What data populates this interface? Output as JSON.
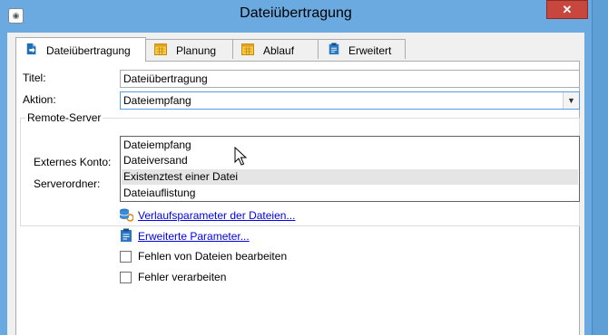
{
  "window": {
    "title": "Dateiübertragung",
    "close_glyph": "✕"
  },
  "tabs": [
    {
      "label": "Dateiübertragung",
      "icon": "file-transfer-icon"
    },
    {
      "label": "Planung",
      "icon": "calendar-icon"
    },
    {
      "label": "Ablauf",
      "icon": "calendar-icon"
    },
    {
      "label": "Erweitert",
      "icon": "clipboard-icon"
    }
  ],
  "form": {
    "title_label": "Titel:",
    "title_value": "Dateiübertragung",
    "action_label": "Aktion:",
    "action_value": "Dateiempfang",
    "remote_server_label": "Remote-Server",
    "external_account_label": "Externes Konto:",
    "server_folder_label": "Serverordner:",
    "server_folder_value": ""
  },
  "action_options": [
    "Dateiempfang",
    "Dateiversand",
    "Existenztest einer Datei",
    "Dateiauflistung"
  ],
  "links": {
    "history_params": "Verlaufsparameter der Dateien...",
    "advanced_params": "Erweiterte Parameter..."
  },
  "checkboxes": {
    "handle_missing_files": {
      "label": "Fehlen von Dateien bearbeiten",
      "checked": false
    },
    "process_errors": {
      "label": "Fehler verarbeiten",
      "checked": false
    }
  }
}
